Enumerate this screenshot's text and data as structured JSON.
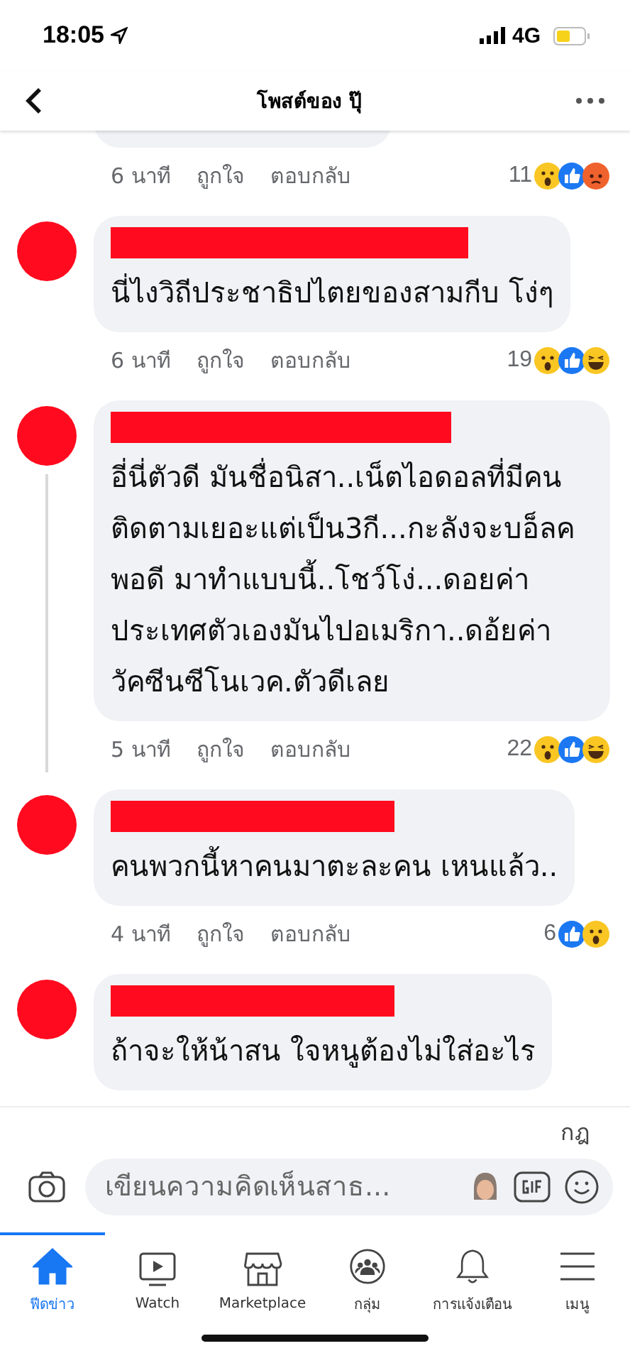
{
  "status_bar": {
    "time": "18:05",
    "network": "4G"
  },
  "header": {
    "title": "โพสต์ของ ปุ๊"
  },
  "comments": [
    {
      "time": "6 นาที",
      "like": "ถูกใจ",
      "reply": "ตอบกลับ",
      "count": "11",
      "reactions": [
        {
          "kind": "wow"
        },
        {
          "kind": "like"
        },
        {
          "kind": "angry"
        }
      ]
    },
    {
      "text": "นี่ไงวิถีประชาธิปไตยของสามกีบ โง่ๆ",
      "time": "6 นาที",
      "like": "ถูกใจ",
      "reply": "ตอบกลับ",
      "count": "19",
      "reactions": [
        {
          "kind": "wow"
        },
        {
          "kind": "like"
        },
        {
          "kind": "haha"
        }
      ]
    },
    {
      "text": "อี่นี่ตัวดี มันชื่อนิสา..เน็ตไอดอลที่มีคนติดตามเยอะแต่เป็น3กี...กะลังจะบอ็ลค พอดี มาทำแบบนี้..โชว์โง่...ดอยค่าประเทศตัวเองมันไปอเมริกา..ดอ้ยค่าวัคซีนซีโนเวค.ตัวดีเลย",
      "time": "5 นาที",
      "like": "ถูกใจ",
      "reply": "ตอบกลับ",
      "count": "22",
      "reactions": [
        {
          "kind": "wow"
        },
        {
          "kind": "like"
        },
        {
          "kind": "haha"
        }
      ],
      "thread": true
    },
    {
      "text": "คนพวกนี้หาคนมาตะละคน  เหนแล้ว..",
      "time": "4 นาที",
      "like": "ถูกใจ",
      "reply": "ตอบกลับ",
      "count": "6",
      "reactions": [
        {
          "kind": "like"
        },
        {
          "kind": "wow"
        }
      ]
    },
    {
      "text": "ถ้าจะให้น้าสน ใจหนูต้องไม่ใส่อะไร"
    }
  ],
  "rules_label": "กฎ",
  "comment_input": {
    "placeholder": "เขียนความคิดเห็นสาธ..."
  },
  "tabs": [
    {
      "label": "ฟีดข่าว",
      "kind": "home",
      "selected": true
    },
    {
      "label": "Watch",
      "kind": "watch",
      "selected": false
    },
    {
      "label": "Marketplace",
      "kind": "store",
      "selected": false
    },
    {
      "label": "กลุ่ม",
      "kind": "groups",
      "selected": false
    },
    {
      "label": "การแจ้งเตือน",
      "kind": "bell",
      "selected": false
    },
    {
      "label": "เมนู",
      "kind": "menu",
      "selected": false
    }
  ]
}
